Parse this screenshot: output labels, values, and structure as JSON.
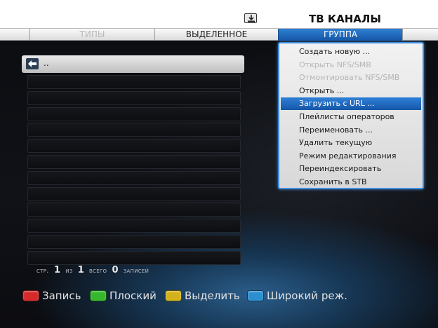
{
  "header": {
    "title": "ТВ КАНАЛЫ",
    "icon": "download-icon"
  },
  "tabs": [
    {
      "label": "ТИПЫ",
      "state": "disabled"
    },
    {
      "label": "ВЫДЕЛЕННОЕ",
      "state": "normal"
    },
    {
      "label": "ГРУППА",
      "state": "active"
    }
  ],
  "list": {
    "back_item": {
      "icon": "back-arrow-icon",
      "label": ".."
    },
    "empty_rows": 12
  },
  "pager": {
    "page_label": "стр.",
    "page": "1",
    "of_label": "из",
    "pages": "1",
    "total_label": "всего",
    "records": "0",
    "records_label": "записей"
  },
  "menu": {
    "items": [
      {
        "label": "Создать новую ...",
        "state": "normal"
      },
      {
        "label": "Открыть NFS/SMB",
        "state": "disabled"
      },
      {
        "label": "Отмонтировать NFS/SMB",
        "state": "disabled"
      },
      {
        "label": "Открыть ...",
        "state": "normal"
      },
      {
        "label": "Загрузить с URL ...",
        "state": "selected"
      },
      {
        "label": "Плейлисты операторов",
        "state": "normal"
      },
      {
        "label": "Переименовать ...",
        "state": "normal"
      },
      {
        "label": "Удалить текущую",
        "state": "normal"
      },
      {
        "label": "Режим редактирования",
        "state": "normal"
      },
      {
        "label": "Переиндексировать",
        "state": "normal"
      },
      {
        "label": "Сохранить в STB",
        "state": "normal"
      }
    ]
  },
  "footer": {
    "keys": [
      {
        "color": "#d42a2a",
        "label": "Запись"
      },
      {
        "color": "#36b82e",
        "label": "Плоский"
      },
      {
        "color": "#d4b21c",
        "label": "Выделить"
      },
      {
        "color": "#2c8fd0",
        "label": "Широкий реж."
      }
    ]
  },
  "colors": {
    "accent": "#2a76c8",
    "menu_border": "#3e8de0"
  }
}
